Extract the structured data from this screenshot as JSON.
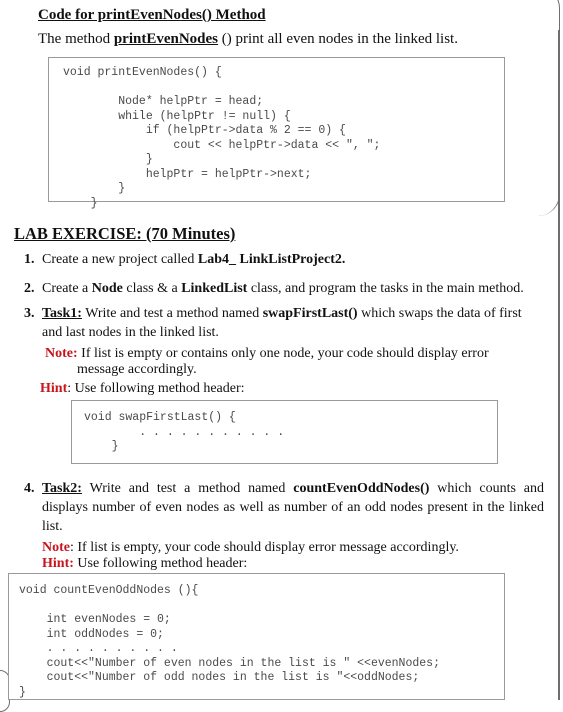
{
  "section_printEven": {
    "heading": "Code for printEvenNodes() Method",
    "intro_prefix": "The method ",
    "intro_method": "printEvenNodes",
    "intro_suffix": " () print all even nodes in the linked list.",
    "code": "void printEvenNodes() {\n\n        Node* helpPtr = head;\n        while (helpPtr != null) {\n            if (helpPtr->data % 2 == 0) {\n                cout << helpPtr->data << \", \";\n            }\n            helpPtr = helpPtr->next;\n        }\n    }"
  },
  "lab": {
    "heading": "LAB EXERCISE: (70 Minutes)",
    "items": [
      {
        "number": "1.",
        "text_prefix": "Create a new project called ",
        "bold": "Lab4_ LinkListProject2."
      },
      {
        "number": "2.",
        "text_a": "Create a ",
        "bold_a": "Node",
        "text_b": " class & a ",
        "bold_b": "LinkedList",
        "text_c": " class, and program the tasks in the main method."
      },
      {
        "number": "3.",
        "task_label": "Task1:",
        "text_prefix": " Write and test a method named ",
        "method": "swapFirstLast()",
        "text_suffix": " which swaps the data of first and last nodes in the linked list.",
        "note_label": "Note:",
        "note_text": " If list is empty or contains only one node, your code should display error",
        "note_cont": "message accordingly.",
        "hint_label": "Hint",
        "hint_text": ": Use following method header:",
        "code": "void swapFirstLast() {\n        . . . . . . . . . . .\n    }"
      },
      {
        "number": "4.",
        "task_label": "Task2:",
        "text_prefix": " Write and test a method named ",
        "method": "countEvenOddNodes()",
        "text_suffix": " which counts and displays number of even nodes as well as number of an odd nodes present in the linked list.",
        "note_label": "Note",
        "note_text": ": If list is empty, your code should display error message accordingly.",
        "hint_label": "Hint:",
        "hint_text": " Use following method header:",
        "code": "void countEvenOddNodes (){\n\n    int evenNodes = 0;\n    int oddNodes = 0;\n    . . . . . . . . . .\n    cout<<\"Number of even nodes in the list is \" <<evenNodes;\n    cout<<\"Number of odd nodes in the list is \"<<oddNodes;\n}"
      }
    ]
  },
  "colors": {
    "note_hint_red": "#c8141c",
    "code_text": "#4a4a4a",
    "box_border": "#9a9a9a"
  }
}
